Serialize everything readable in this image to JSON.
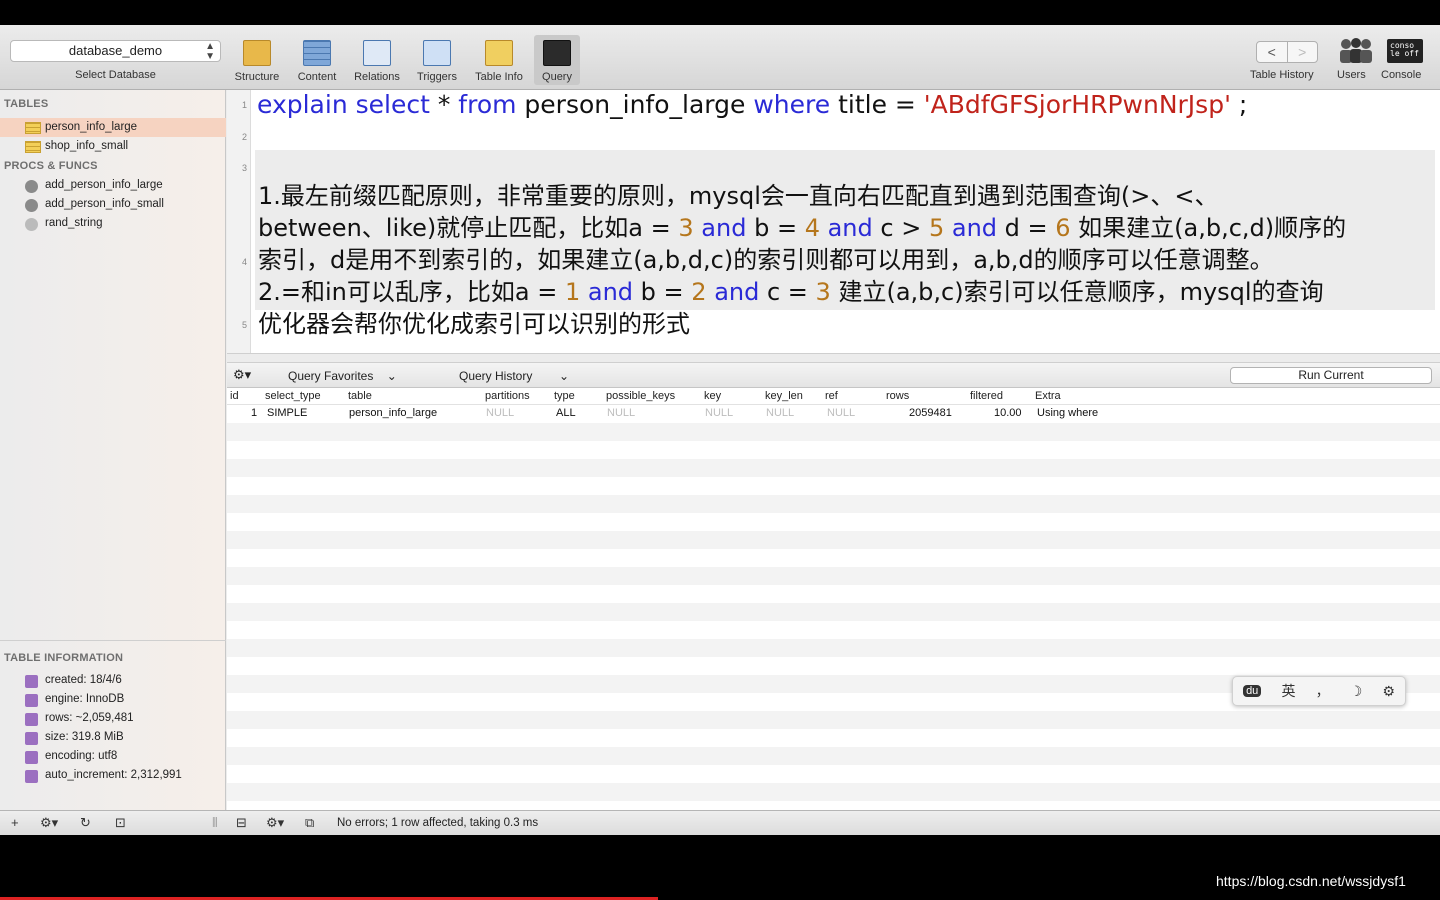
{
  "toolbar": {
    "database_value": "database_demo",
    "database_caption": "Select Database",
    "buttons": [
      "Structure",
      "Content",
      "Relations",
      "Triggers",
      "Table Info",
      "Query"
    ],
    "nav_back": "<",
    "nav_forward": ">",
    "table_history": "Table History",
    "users": "Users",
    "console": "Console",
    "console_icon_text": "conso le off"
  },
  "sidebar": {
    "tables_header": "TABLES",
    "tables": [
      "person_info_large",
      "shop_info_small"
    ],
    "procs_header": "PROCS & FUNCS",
    "procs": [
      "add_person_info_large",
      "add_person_info_small",
      "rand_string"
    ],
    "info_header": "TABLE INFORMATION",
    "info": [
      "created: 18/4/6",
      "engine: InnoDB",
      "rows: ~2,059,481",
      "size: 319.8 MiB",
      "encoding: utf8",
      "auto_increment: 2,312,991"
    ]
  },
  "editor": {
    "line_numbers": [
      "1",
      "2",
      "3",
      "4",
      "5"
    ],
    "line1": {
      "kw1": "explain select",
      "t1": " * ",
      "kw2": "from",
      "t2": " person_info_large ",
      "kw3": "where",
      "t3": "  title = ",
      "str": "'ABdfGFSjorHRPwnNrJsp'",
      "t4": " ;"
    },
    "comment": {
      "l1": "1.最左前缀匹配原则，非常重要的原则，mysql会一直向右匹配直到遇到范围查询(>、<、",
      "l2a": "between、like)就停止匹配，比如a = ",
      "l2n1": "3",
      "l2k1": " and ",
      "l2b": "b = ",
      "l2n2": "4",
      "l2k2": " and ",
      "l2c": "c > ",
      "l2n3": "5",
      "l2k3": " and ",
      "l2d": "d = ",
      "l2n4": "6",
      "l2e": " 如果建立(a,b,c,d)顺序的",
      "l3": "索引，d是用不到索引的，如果建立(a,b,d,c)的索引则都可以用到，a,b,d的顺序可以任意调整。",
      "l4a": "2.=和in可以乱序，比如a = ",
      "l4n1": "1",
      "l4k1": " and ",
      "l4b": "b = ",
      "l4n2": "2",
      "l4k2": " and ",
      "l4c": "c = ",
      "l4n3": "3",
      "l4d": " 建立(a,b,c)索引可以任意顺序，mysql的查询",
      "l5": "优化器会帮你优化成索引可以识别的形式"
    }
  },
  "querybar": {
    "favorites": "Query Favorites",
    "history": "Query History",
    "run": "Run Current"
  },
  "results": {
    "columns": [
      "id",
      "select_type",
      "table",
      "partitions",
      "type",
      "possible_keys",
      "key",
      "key_len",
      "ref",
      "rows",
      "filtered",
      "Extra"
    ],
    "row": [
      "1",
      "SIMPLE",
      "person_info_large",
      "NULL",
      "ALL",
      "NULL",
      "NULL",
      "NULL",
      "NULL",
      "2059481",
      "10.00",
      "Using where"
    ]
  },
  "status": "No errors; 1 row affected, taking 0.3 ms",
  "ime": {
    "logo": "du",
    "lang": "英",
    "punct": "，",
    "moon": "☽",
    "gear": "⚙"
  },
  "watermark": "https://blog.csdn.net/wssjdysf1",
  "colors": {
    "keyword": "#2a2ad6",
    "string": "#c0231b",
    "number": "#b5761c",
    "selected_table": "#f6d3c1"
  }
}
